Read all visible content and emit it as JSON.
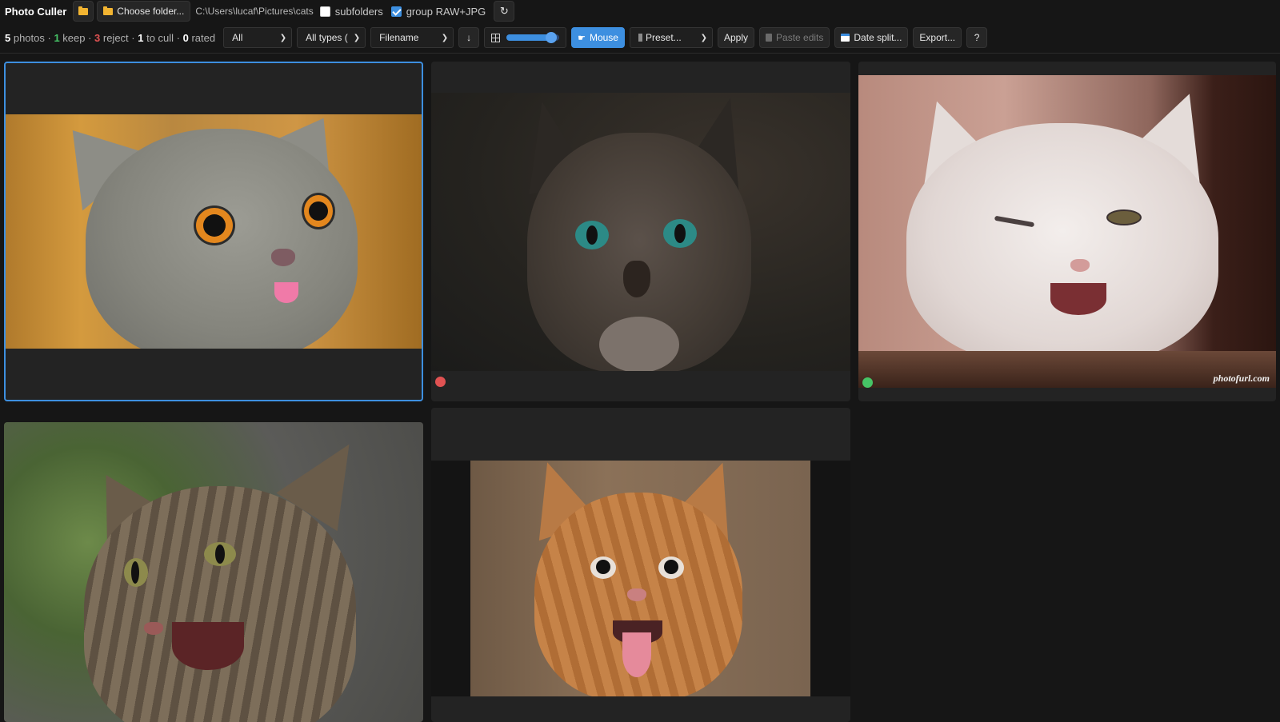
{
  "app": {
    "title": "Photo Culler"
  },
  "toolbar": {
    "open_icon": "folder-open-icon",
    "choose_folder_label": "Choose folder...",
    "folder_path": "C:\\Users\\lucaf\\Pictures\\cats",
    "subfolders": {
      "label": "subfolders",
      "checked": false
    },
    "group_raw_jpg": {
      "label": "group RAW+JPG",
      "checked": true
    },
    "refresh_icon": "↻"
  },
  "stats": {
    "photos_count": "5",
    "photos_label": " photos · ",
    "keep_count": "1",
    "keep_label": " keep · ",
    "reject_count": "3",
    "reject_label": " reject · ",
    "cull_count": "1",
    "cull_label": " to cull · ",
    "rated_count": "0",
    "rated_label": " rated"
  },
  "filters": {
    "status": "All",
    "types": "All types (",
    "sort": "Filename",
    "sort_direction": "↓"
  },
  "thumbnail_size": {
    "value_fraction": 0.85
  },
  "actions": {
    "mouse_label": "Mouse",
    "preset_label": "Preset...",
    "apply_label": "Apply",
    "paste_edits_label": "Paste edits",
    "date_split_label": "Date split...",
    "export_label": "Export...",
    "help_label": "?"
  },
  "photos": [
    {
      "subject": "grey-kitten",
      "selected": true,
      "status": "none"
    },
    {
      "subject": "siamese-cat",
      "selected": false,
      "status": "reject"
    },
    {
      "subject": "white-kitten",
      "selected": false,
      "status": "keep",
      "watermark": "photofurl.com"
    },
    {
      "subject": "tabby-cat",
      "selected": false,
      "status": "none"
    },
    {
      "subject": "orange-kitten",
      "selected": false,
      "status": "none"
    }
  ],
  "colors": {
    "accent": "#3d8fe0",
    "keep": "#46c466",
    "reject": "#e05252"
  }
}
